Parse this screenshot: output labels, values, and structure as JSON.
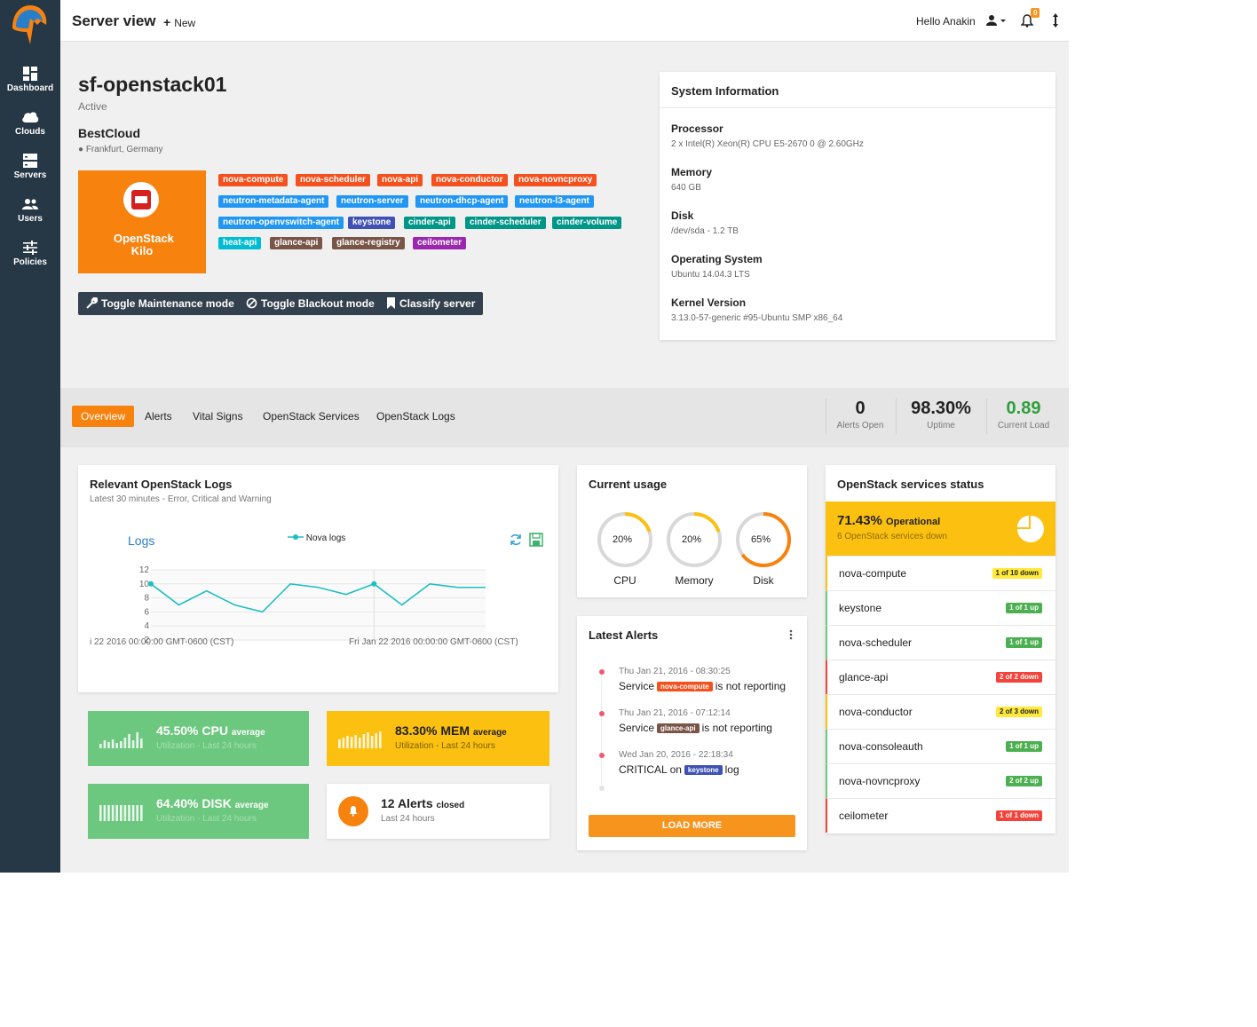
{
  "nav": [
    {
      "label": "Dashboard",
      "icon": "dashboard-icon"
    },
    {
      "label": "Clouds",
      "icon": "cloud-icon"
    },
    {
      "label": "Servers",
      "icon": "server-icon"
    },
    {
      "label": "Users",
      "icon": "users-icon"
    },
    {
      "label": "Policies",
      "icon": "sliders-icon"
    }
  ],
  "topbar": {
    "title": "Server view",
    "new_label": "New",
    "greeting": "Hello Anakin",
    "notifications": "0"
  },
  "server": {
    "name": "sf-openstack01",
    "status": "Active",
    "cloud": "BestCloud",
    "location": "Frankfurt, Germany",
    "platform": "OpenStack Kilo"
  },
  "tags": [
    {
      "label": "nova-compute",
      "color": "#f4511e"
    },
    {
      "label": "nova-scheduler",
      "color": "#f4511e"
    },
    {
      "label": "nova-api",
      "color": "#f4511e"
    },
    {
      "label": "nova-conductor",
      "color": "#f4511e"
    },
    {
      "label": "nova-novncproxy",
      "color": "#f4511e"
    },
    {
      "label": "neutron-metadata-agent",
      "color": "#2196f3"
    },
    {
      "label": "neutron-server",
      "color": "#2196f3"
    },
    {
      "label": "neutron-dhcp-agent",
      "color": "#2196f3"
    },
    {
      "label": "neutron-l3-agent",
      "color": "#2196f3"
    },
    {
      "label": "neutron-openvswitch-agent",
      "color": "#2196f3"
    },
    {
      "label": "keystone",
      "color": "#3f51b5"
    },
    {
      "label": "cinder-api",
      "color": "#009688"
    },
    {
      "label": "cinder-scheduler",
      "color": "#009688"
    },
    {
      "label": "cinder-volume",
      "color": "#009688"
    },
    {
      "label": "heat-api",
      "color": "#00bcd4"
    },
    {
      "label": "glance-api",
      "color": "#795548"
    },
    {
      "label": "glance-registry",
      "color": "#795548"
    },
    {
      "label": "ceilometer",
      "color": "#9c27b0"
    }
  ],
  "actions": [
    "Toggle Maintenance mode",
    "Toggle Blackout mode",
    "Classify server"
  ],
  "system_info": {
    "title": "System Information",
    "items": [
      {
        "label": "Processor",
        "value": "2 x Intel(R) Xeon(R) CPU E5-2670 0 @ 2.60GHz"
      },
      {
        "label": "Memory",
        "value": "640 GB"
      },
      {
        "label": "Disk",
        "value": "/dev/sda - 1.2 TB"
      },
      {
        "label": "Operating System",
        "value": "Ubuntu 14.04.3 LTS"
      },
      {
        "label": "Kernel Version",
        "value": "3.13.0-57-generic #95-Ubuntu SMP x86_64"
      }
    ]
  },
  "tabs": [
    "Overview",
    "Alerts",
    "Vital Signs",
    "OpenStack Services",
    "OpenStack Logs"
  ],
  "stats": [
    {
      "value": "0",
      "label": "Alerts Open",
      "color": "#222222"
    },
    {
      "value": "98.30%",
      "label": "Uptime",
      "color": "#222222"
    },
    {
      "value": "0.89",
      "label": "Current Load",
      "color": "#2e9e3a"
    }
  ],
  "logs": {
    "title": "Relevant OpenStack Logs",
    "subtitle": "Latest 30 minutes - Error, Critical and Warning",
    "chart_title": "Logs",
    "x_start_label": "i 22 2016 00:00:00 GMT-0600 (CST)",
    "x_end_label": "Fri Jan 22 2016 00:00:00 GMT-0600 (CST)"
  },
  "chart_data": {
    "type": "line",
    "title": "Logs",
    "series": [
      {
        "name": "Nova logs",
        "values": [
          10,
          7,
          9,
          7,
          6,
          10,
          9.5,
          8.5,
          10,
          7,
          10,
          9.5,
          9.5
        ]
      }
    ],
    "ylim": [
      2,
      12
    ],
    "yticks": [
      2,
      4,
      6,
      8,
      10,
      12
    ],
    "grid": true,
    "legend": "top"
  },
  "usage": {
    "title": "Current usage",
    "gauges": [
      {
        "label": "CPU",
        "value": 20,
        "text": "20%",
        "color": "#fcc010"
      },
      {
        "label": "Memory",
        "value": 20,
        "text": "20%",
        "color": "#fcc010"
      },
      {
        "label": "Disk",
        "value": 65,
        "text": "65%",
        "color": "#f7820e"
      }
    ]
  },
  "alerts": {
    "title": "Latest Alerts",
    "items": [
      {
        "time": "Thu Jan 21, 2016 - 08:30:25",
        "prefix": "Service",
        "tag": "nova-compute",
        "tag_color": "#f4511e",
        "suffix": "is not reporting"
      },
      {
        "time": "Thu Jan 21, 2016 - 07:12:14",
        "prefix": "Service",
        "tag": "glance-api",
        "tag_color": "#795548",
        "suffix": "is not reporting"
      },
      {
        "time": "Wed Jan 20, 2016 - 22:18:34",
        "prefix": "CRITICAL on",
        "tag": "keystone",
        "tag_color": "#3f51b5",
        "suffix": "log"
      }
    ],
    "load_more": "LOAD MORE"
  },
  "services_status": {
    "title": "OpenStack services status",
    "percent": "71.43%",
    "percent_label": "Operational",
    "down_text": "6 OpenStack services down",
    "items": [
      {
        "name": "nova-compute",
        "badge": "1 of 10 down",
        "state": "warn"
      },
      {
        "name": "keystone",
        "badge": "1 of 1 up",
        "state": "ok"
      },
      {
        "name": "nova-scheduler",
        "badge": "1 of 1 up",
        "state": "ok"
      },
      {
        "name": "glance-api",
        "badge": "2 of 2 down",
        "state": "down"
      },
      {
        "name": "nova-conductor",
        "badge": "2 of 3 down",
        "state": "warn"
      },
      {
        "name": "nova-consoleauth",
        "badge": "1 of 1 up",
        "state": "ok"
      },
      {
        "name": "nova-novncproxy",
        "badge": "2 of 2 up",
        "state": "ok"
      },
      {
        "name": "ceilometer",
        "badge": "1 of 1 down",
        "state": "down"
      }
    ]
  },
  "kpis": {
    "cpu": {
      "value": "45.50% CPU",
      "unit": "average",
      "sub": "Utilization - Last 24 hours"
    },
    "mem": {
      "value": "83.30% MEM",
      "unit": "average",
      "sub": "Utilization - Last 24 hours"
    },
    "disk": {
      "value": "64.40% DISK",
      "unit": "average",
      "sub": "Utilization - Last 24 hours"
    },
    "alerts": {
      "value": "12 Alerts",
      "unit": "closed",
      "sub": "Last 24 hours"
    }
  }
}
